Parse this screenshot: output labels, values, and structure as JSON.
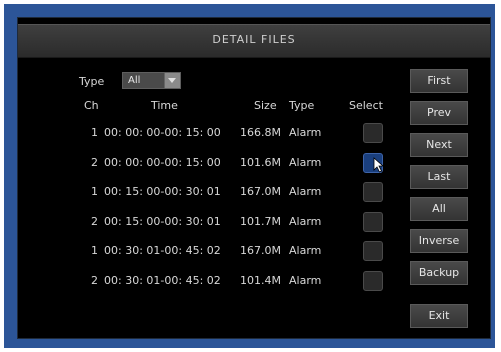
{
  "window": {
    "title": "DETAIL FILES"
  },
  "filter": {
    "type_label": "Type",
    "type_value": "All"
  },
  "table": {
    "headers": {
      "ch": "Ch",
      "time": "Time",
      "size": "Size",
      "type": "Type",
      "select": "Select"
    },
    "rows": [
      {
        "ch": "1",
        "time": "00: 00: 00-00: 15: 00",
        "size": "166.8M",
        "type": "Alarm",
        "selected": false
      },
      {
        "ch": "2",
        "time": "00: 00: 00-00: 15: 00",
        "size": "101.6M",
        "type": "Alarm",
        "selected": true
      },
      {
        "ch": "1",
        "time": "00: 15: 00-00: 30: 01",
        "size": "167.0M",
        "type": "Alarm",
        "selected": false
      },
      {
        "ch": "2",
        "time": "00: 15: 00-00: 30: 01",
        "size": "101.7M",
        "type": "Alarm",
        "selected": false
      },
      {
        "ch": "1",
        "time": "00: 30: 01-00: 45: 02",
        "size": "167.0M",
        "type": "Alarm",
        "selected": false
      },
      {
        "ch": "2",
        "time": "00: 30: 01-00: 45: 02",
        "size": "101.4M",
        "type": "Alarm",
        "selected": false
      }
    ]
  },
  "buttons": {
    "first": "First",
    "prev": "Prev",
    "next": "Next",
    "last": "Last",
    "all": "All",
    "inverse": "Inverse",
    "backup": "Backup",
    "exit": "Exit"
  },
  "colors": {
    "frame": "#2c5598",
    "panel": "#000000",
    "selected": "#1a3f7e"
  }
}
